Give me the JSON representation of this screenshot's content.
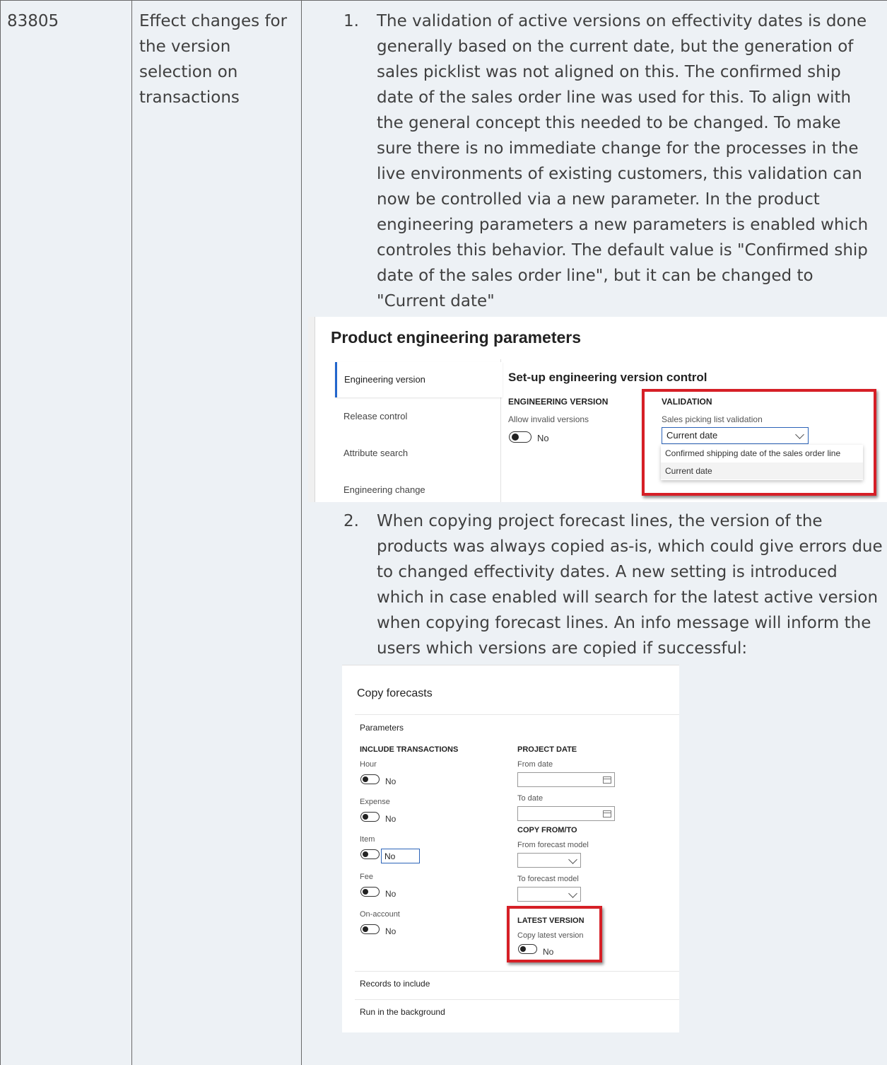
{
  "row": {
    "id": "83805",
    "title": "Effect changes for the version selection on transactions"
  },
  "items": [
    {
      "number": "1.",
      "text": "The validation of active versions on effectivity dates is done generally based on the current date, but the generation of sales picklist was not aligned on this. The confirmed ship date of the sales order line was used for this. To align with the general concept this needed to be changed. To make sure there is no immediate change for the processes in the live environments of existing customers, this validation can now be controlled via a new parameter. In the product engineering parameters a new parameters is enabled which controles this behavior. The default value is \"Confirmed ship date of the sales order line\", but it can be changed to \"Current date\""
    },
    {
      "number": "2.",
      "text": "When copying project forecast lines, the version of the products was always copied as-is, which could give errors due to changed effectivity dates. A new setting is introduced which in case enabled will search for the latest active version when copying forecast lines. An info message will inform the users which versions are copied if successful:"
    }
  ],
  "shot1": {
    "title": "Product engineering parameters",
    "nav": [
      "Engineering version",
      "Release control",
      "Attribute search",
      "Engineering change"
    ],
    "section_title": "Set-up engineering version control",
    "engineering_version": {
      "heading": "ENGINEERING VERSION",
      "label": "Allow invalid versions",
      "value": "No"
    },
    "validation": {
      "heading": "VALIDATION",
      "label": "Sales picking list validation",
      "selected": "Current date",
      "options": [
        "Confirmed shipping date of the sales order line",
        "Current date"
      ]
    },
    "highlight_color": "#d61f26",
    "accent_color": "#2266cc"
  },
  "shot2": {
    "title": "Copy forecasts",
    "parameters_label": "Parameters",
    "include_transactions": {
      "heading": "INCLUDE TRANSACTIONS",
      "toggles": [
        {
          "label": "Hour",
          "value": "No"
        },
        {
          "label": "Expense",
          "value": "No"
        },
        {
          "label": "Item",
          "value": "No"
        },
        {
          "label": "Fee",
          "value": "No"
        },
        {
          "label": "On-account",
          "value": "No"
        }
      ]
    },
    "project_date": {
      "heading": "PROJECT DATE",
      "from_label": "From date",
      "to_label": "To date"
    },
    "copy_from_to": {
      "heading": "COPY FROM/TO",
      "from_label": "From forecast model",
      "to_label": "To forecast model"
    },
    "latest_version": {
      "heading": "LATEST VERSION",
      "label": "Copy latest version",
      "value": "No"
    },
    "records_label": "Records to include",
    "background_label": "Run in the background"
  }
}
